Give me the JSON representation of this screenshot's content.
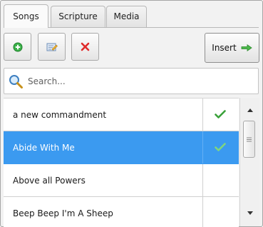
{
  "tabs": [
    {
      "label": "Songs",
      "active": true
    },
    {
      "label": "Scripture",
      "active": false
    },
    {
      "label": "Media",
      "active": false
    }
  ],
  "toolbar": {
    "add_icon": "add-icon",
    "edit_icon": "edit-icon",
    "delete_icon": "delete-icon",
    "insert_label": "Insert",
    "insert_icon": "arrow-right-icon"
  },
  "search": {
    "placeholder": "Search...",
    "value": ""
  },
  "songs": [
    {
      "title": "a new commandment",
      "checked": true,
      "selected": false
    },
    {
      "title": "Abide With Me",
      "checked": true,
      "selected": true
    },
    {
      "title": "Above all Powers",
      "checked": false,
      "selected": false
    },
    {
      "title": "Beep Beep I'm A Sheep",
      "checked": false,
      "selected": false
    }
  ],
  "colors": {
    "selection": "#3b9af0",
    "check": "#3aa13a"
  }
}
